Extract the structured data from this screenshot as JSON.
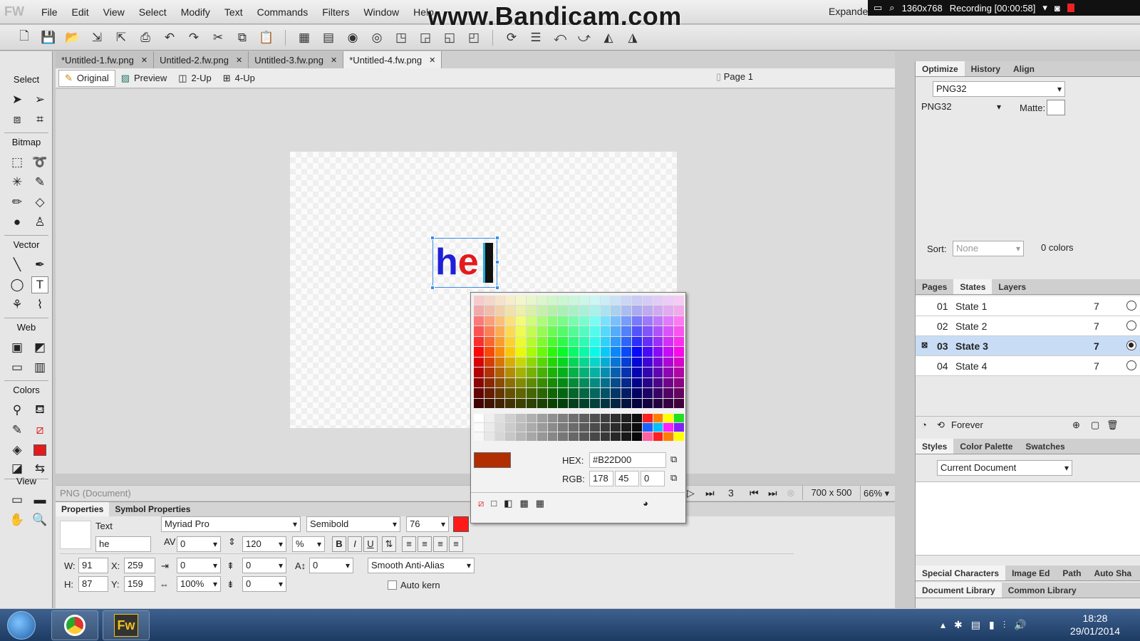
{
  "app": {
    "logo": "FW",
    "expand_label": "Expande"
  },
  "watermark": "www.Bandicam.com",
  "recorder": {
    "resolution": "1360x768",
    "status": "Recording [00:00:58]"
  },
  "menu": [
    "File",
    "Edit",
    "View",
    "Select",
    "Modify",
    "Text",
    "Commands",
    "Filters",
    "Window",
    "Help"
  ],
  "tools": {
    "sections": {
      "select": "Select",
      "bitmap": "Bitmap",
      "vector": "Vector",
      "web": "Web",
      "colors": "Colors",
      "view": "View"
    }
  },
  "doc_tabs": [
    {
      "label": "*Untitled-1.fw.png",
      "active": false
    },
    {
      "label": "Untitled-2.fw.png",
      "active": false
    },
    {
      "label": "Untitled-3.fw.png",
      "active": false
    },
    {
      "label": "*Untitled-4.fw.png",
      "active": true
    }
  ],
  "view_tabs": [
    "Original",
    "Preview",
    "2-Up",
    "4-Up"
  ],
  "page_selector": "Page 1",
  "canvas_text": {
    "h": "h",
    "e": "e"
  },
  "color_picker": {
    "hex_label": "HEX:",
    "hex": "#B22D00",
    "rgb_label": "RGB:",
    "r": "178",
    "g": "45",
    "b": "0",
    "current_color": "#b22d00"
  },
  "statusbar": {
    "doc_type": "PNG (Document)",
    "frame": "3",
    "size": "700 x 500",
    "zoom": "66%"
  },
  "properties": {
    "tabs": [
      "Properties",
      "Symbol Properties"
    ],
    "object_type": "Text",
    "object_name": "he",
    "font": "Myriad Pro",
    "style": "Semibold",
    "size": "76",
    "fill_color": "#ff1a1a",
    "kerning": "0",
    "leading": "120",
    "leading_unit": "%",
    "indent": "0",
    "space_before": "0",
    "baseline": "0",
    "horiz_scale": "100%",
    "space_after": "0",
    "antialias": "Smooth Anti-Alias",
    "autokern": "Auto kern",
    "w_label": "W:",
    "w": "91",
    "x_label": "X:",
    "x": "259",
    "h_label": "H:",
    "h": "87",
    "y_label": "Y:",
    "y": "159"
  },
  "optimize": {
    "tabs": [
      "Optimize",
      "History",
      "Align"
    ],
    "preset": "PNG32",
    "format": "PNG32",
    "matte_label": "Matte:",
    "sort_label": "Sort:",
    "sort_value": "None",
    "colors": "0 colors"
  },
  "states_panel": {
    "tabs": [
      "Pages",
      "States",
      "Layers"
    ],
    "states": [
      {
        "num": "01",
        "name": "State 1",
        "delay": "7",
        "selected": false
      },
      {
        "num": "02",
        "name": "State 2",
        "delay": "7",
        "selected": false
      },
      {
        "num": "03",
        "name": "State 3",
        "delay": "7",
        "selected": true
      },
      {
        "num": "04",
        "name": "State 4",
        "delay": "7",
        "selected": false
      }
    ],
    "loop": "Forever"
  },
  "styles_panel": {
    "tabs": [
      "Styles",
      "Color Palette",
      "Swatches"
    ],
    "library": "Current Document"
  },
  "bottom_tabs_1": [
    "Special Characters",
    "Image Ed",
    "Path",
    "Auto Sha"
  ],
  "bottom_tabs_2": [
    "Document Library",
    "Common Library"
  ],
  "taskbar": {
    "app_label": "Fw",
    "time": "18:28",
    "date": "29/01/2014"
  }
}
